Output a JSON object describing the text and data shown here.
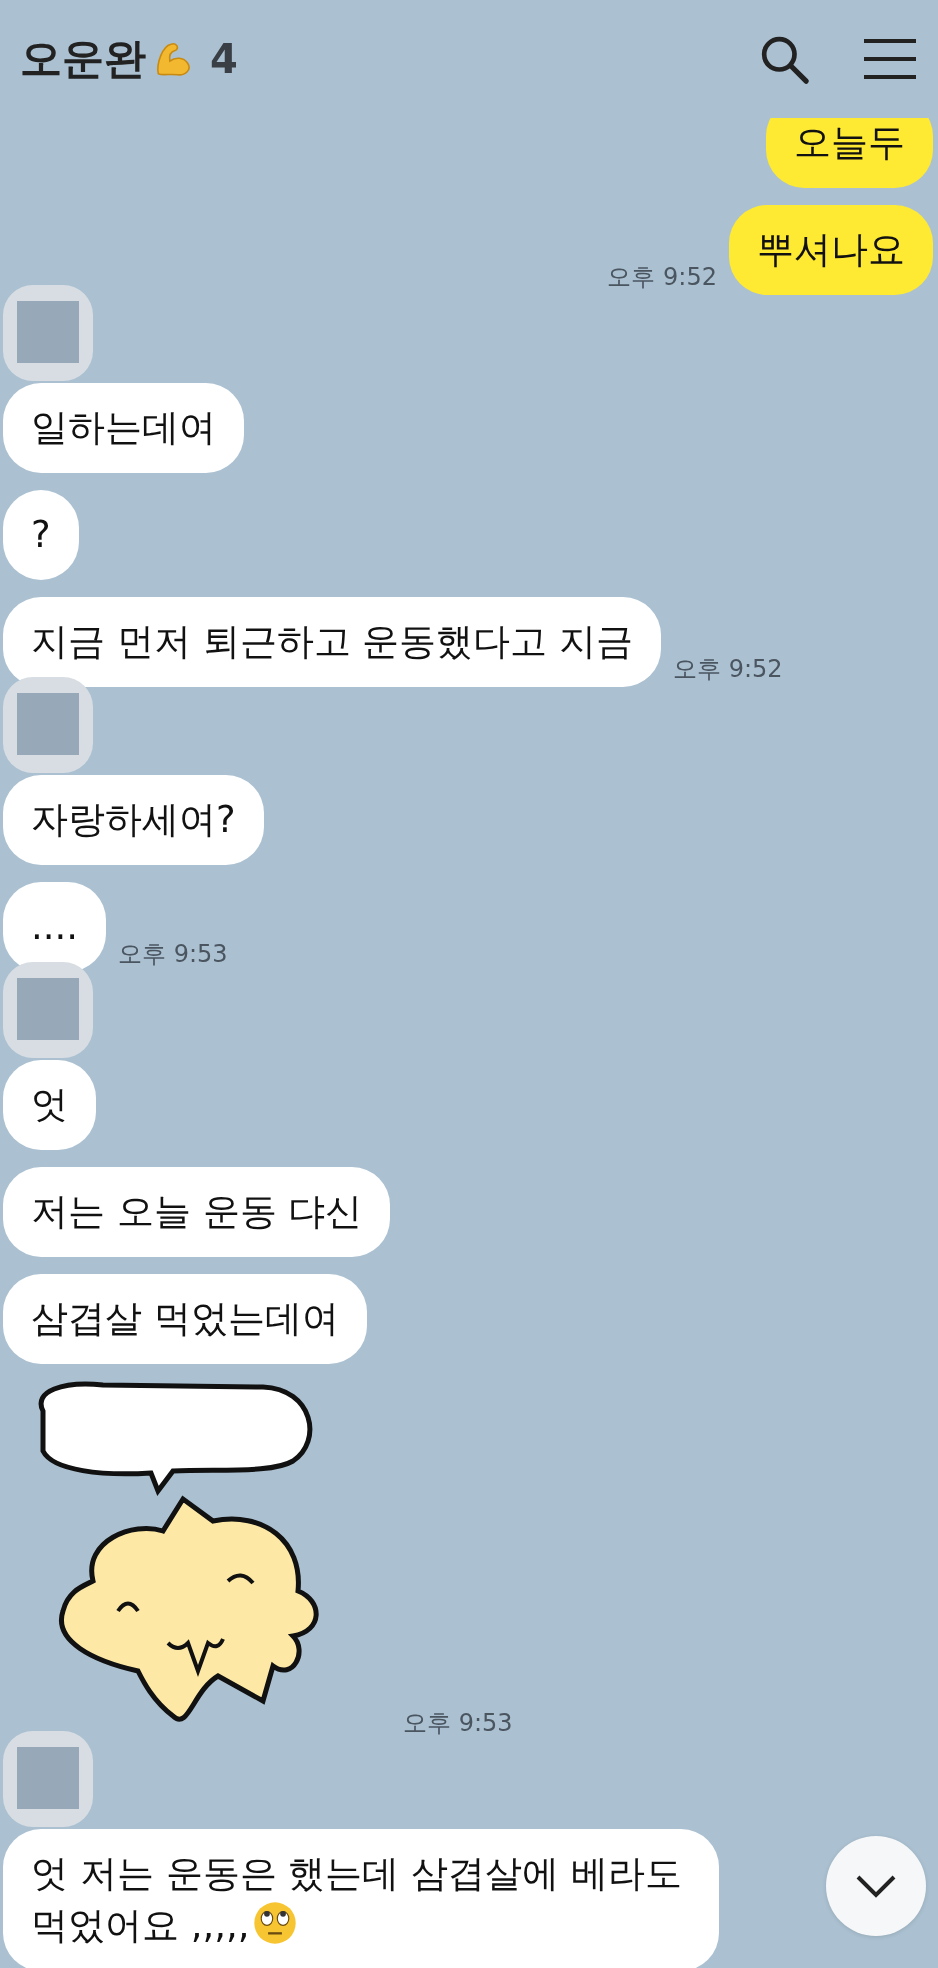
{
  "header": {
    "title": "오운완",
    "member_count": "4"
  },
  "messages": [
    {
      "kind": "mine",
      "text": "오늘두",
      "clipped": true
    },
    {
      "kind": "mine",
      "text": "뿌셔나요",
      "time": "오후 9:52"
    },
    {
      "kind": "avatar"
    },
    {
      "kind": "theirs",
      "text": "일하는데여"
    },
    {
      "kind": "theirs",
      "text": "?"
    },
    {
      "kind": "theirs",
      "text": "지금 먼저 퇴근하고 운동했다고 지금",
      "time": "오후 9:52"
    },
    {
      "kind": "avatar"
    },
    {
      "kind": "theirs",
      "text": "자랑하세여?"
    },
    {
      "kind": "theirs",
      "text": "....",
      "time": "오후 9:53"
    },
    {
      "kind": "avatar"
    },
    {
      "kind": "theirs",
      "text": "엇"
    },
    {
      "kind": "theirs",
      "text": "저는 오늘 운동 댜신"
    },
    {
      "kind": "theirs",
      "text": "삼겹살 먹었는데여"
    },
    {
      "kind": "sticker",
      "time": "오후 9:53"
    },
    {
      "kind": "avatar"
    },
    {
      "kind": "theirs",
      "text": "엇 저는 운동은 했는데 삼겹살에 베라도 먹었어요 ,,,,,",
      "emoji": true
    }
  ]
}
